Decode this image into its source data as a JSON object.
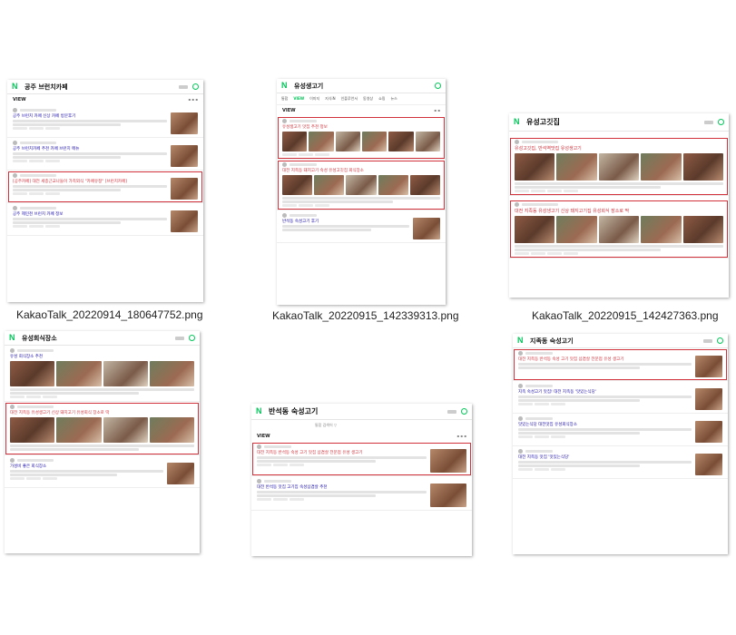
{
  "files": [
    {
      "caption": "KakaoTalk_20220914_180647752.png",
      "search_title": "공주 브런치카페"
    },
    {
      "caption": "KakaoTalk_20220915_142339313.png",
      "search_title": "유성생고기"
    },
    {
      "caption": "KakaoTalk_20220915_142427363.png",
      "search_title": "유성고깃집"
    },
    {
      "caption": "",
      "search_title": "유성회식장소"
    },
    {
      "caption": "",
      "search_title": "반석동 숙성고기"
    },
    {
      "caption": "",
      "search_title": "지족동 숙성고기"
    }
  ],
  "common": {
    "view_label": "VIEW"
  },
  "tile1": {
    "posts": [
      {
        "title": "공주 브런치 카페 신상 카페 방문후기"
      },
      {
        "title": "공주 브런치카페 추천 카페 브런치 메뉴"
      },
      {
        "title": "[공주카페] 대전 세종근교나들이 가족외식 \"카페유정\" [브런치카페]"
      },
      {
        "title": "공주 제민천 브런치 카페 정보"
      }
    ]
  },
  "tile2": {
    "tabs": [
      "통합",
      "VIEW",
      "이미지",
      "지식iN",
      "인플루언서",
      "동영상",
      "쇼핑",
      "뉴스",
      "어학사전",
      "지도"
    ],
    "posts": [
      {
        "title": "유성생고기 맛집 추천 정보"
      },
      {
        "title": "대전 지족동 돼지고기 숙성 유성고깃집 회식장소"
      },
      {
        "title": "반석동 숙성고기 후기"
      }
    ]
  },
  "tile3": {
    "posts": [
      {
        "title": "유성고깃집, 반석역맛집 유성생고기"
      },
      {
        "title": "대전 지족동 유성생고기 신상 돼지고기집 유성회식 장소로 딱"
      }
    ]
  },
  "tile4": {
    "posts": [
      {
        "title": "유성 회식장소 추천"
      },
      {
        "title": "대전 지족동 유성생고기 신상 돼지고기 유성회식 장소로 딱"
      },
      {
        "title": "가성비 좋은 회식장소"
      }
    ]
  },
  "tile5": {
    "sub": "통합 검색어 ▽",
    "posts": [
      {
        "title": "대전 지족동 반석동 숙성 고기 맛집 삼겹살 전문점 유성 생고기"
      },
      {
        "title": "대전 반석동 맛집 고기집 숙성삼겹살 추천"
      }
    ]
  },
  "tile6": {
    "posts": [
      {
        "title": "대전 지족동 반석동 숙성 고기 맛집 삼겹살 전문점 유성 생고기"
      },
      {
        "title": "지족 숙성고기 맛집! 대전 지족동 '맛있는식당'"
      },
      {
        "title": "맛있는식당 대전맛집 유성회식장소"
      },
      {
        "title": "대전 지족동 맛집 '맛있는식당'"
      }
    ]
  }
}
